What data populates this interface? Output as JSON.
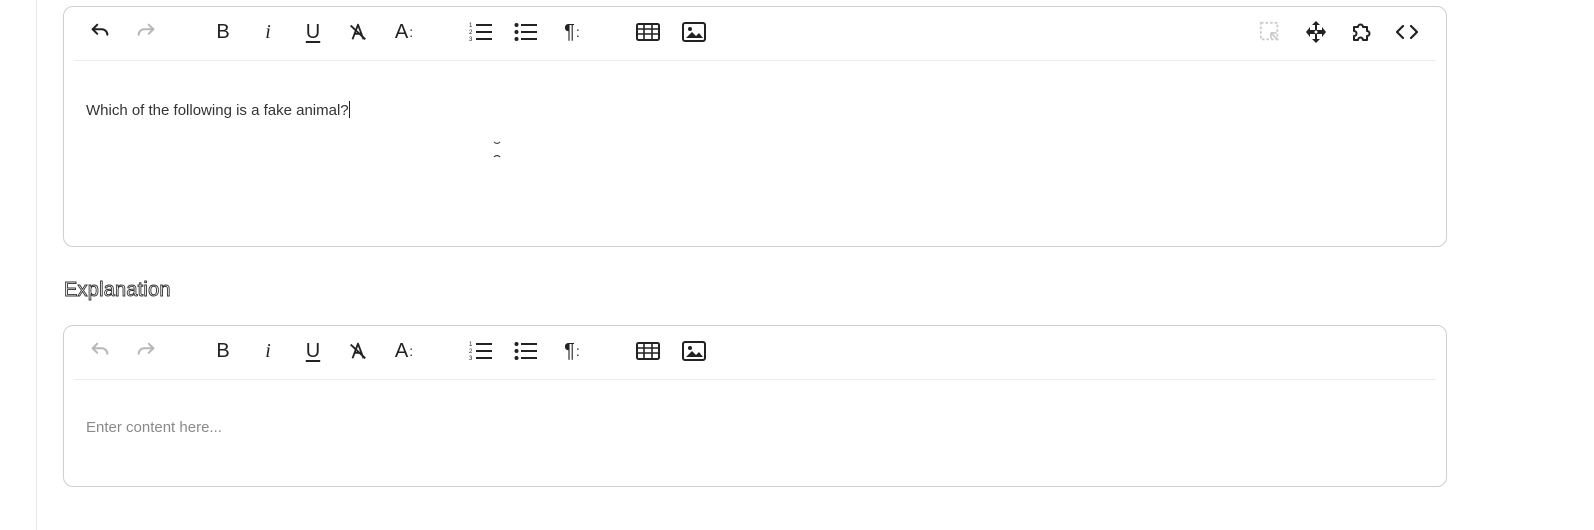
{
  "question_editor": {
    "text": "Which of the following is a fake animal?",
    "toolbar": {
      "undo": "undo-icon",
      "redo": "redo-icon",
      "bold": "B",
      "italic": "i",
      "underline": "U",
      "clear_format": "clear-format-icon",
      "font_size": "A",
      "ordered_list": "ordered-list-icon",
      "unordered_list": "unordered-list-icon",
      "paragraph": "¶",
      "table": "table-icon",
      "image": "image-icon",
      "select_all": "select-all-icon",
      "move": "move-icon",
      "plugin": "puzzle-icon",
      "code": "code-view-icon"
    }
  },
  "explanation_section": {
    "label": "Explanation",
    "placeholder": "Enter content here..."
  },
  "colors": {
    "border": "#cfcfcf",
    "icon": "#222222",
    "placeholder": "#8a8a8a",
    "disabled": "#b5b5b5"
  }
}
